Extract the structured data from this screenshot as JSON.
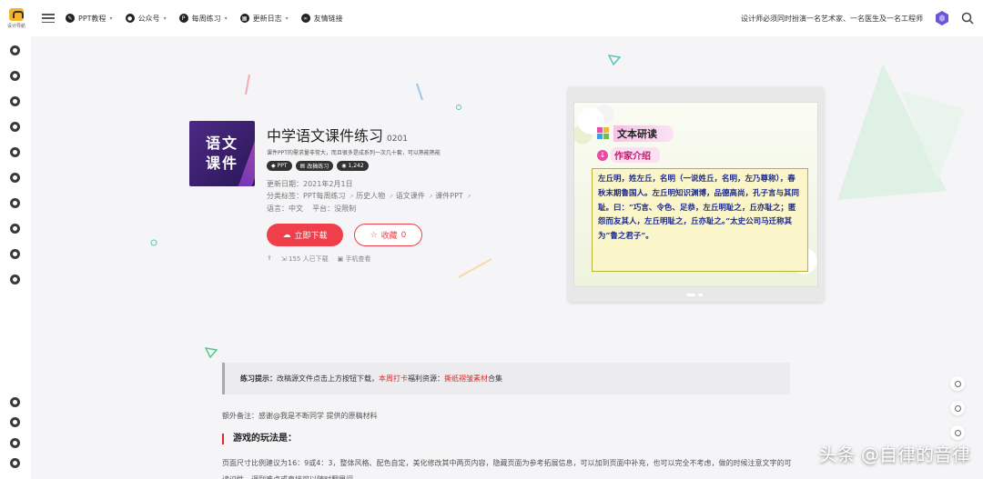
{
  "header": {
    "logo_text": "设计导航",
    "nav": [
      {
        "icon": "pencil-icon",
        "label": "PPT教程",
        "has_dropdown": true
      },
      {
        "icon": "wechat-icon",
        "label": "公众号",
        "has_dropdown": true
      },
      {
        "icon": "letter-p-icon",
        "label": "每周练习",
        "has_dropdown": true
      },
      {
        "icon": "calendar-icon",
        "label": "更新日志",
        "has_dropdown": true
      },
      {
        "icon": "handshake-icon",
        "label": "友情链接",
        "has_dropdown": false
      }
    ],
    "slogan": "设计师必须同时扮演一名艺术家、一名医生及一名工程师"
  },
  "resource": {
    "title": "中学语文课件练习",
    "code": "0201",
    "subtitle": "课件PPT的需求量非常大，而且很多是成系列一次几十套，可以熟能熟能",
    "cover_lines": [
      "语文",
      "课件"
    ],
    "tags": [
      {
        "icon": "diamond-icon",
        "label": "PPT"
      },
      {
        "icon": "document-icon",
        "label": "改稿练习"
      },
      {
        "icon": "eye-icon",
        "label": "1,242"
      }
    ],
    "update_label": "更新日期：",
    "update_date": "2021年2月1日",
    "category_label": "分类标签：",
    "categories": [
      "PPT每周练习",
      "历史人物",
      "语文课件",
      "课件PPT"
    ],
    "language_label": "语言：",
    "language": "中文",
    "platform_label": "平台：",
    "platform": "没限制",
    "download_label": "立即下载",
    "favorite_label": "收藏",
    "favorite_count": "0",
    "share_label": "",
    "downloads_text": "155 人已下载",
    "mobile_label": "手机查看"
  },
  "preview": {
    "heading": "文本研读",
    "subheading": "作家介绍",
    "body": "左丘明，姓左丘，名明（一说姓丘，名明，左乃尊称），春秋末期鲁国人。左丘明知识渊博，品德高尚，孔子言与其同耻。曰：“巧言、令色、足恭，左丘明耻之，丘亦耻之；匿怨而友其人，左丘明耻之，丘亦耻之。”太史公司马迁称其为“鲁之君子”。"
  },
  "content": {
    "notice_prefix": "练习提示：",
    "notice_text": "改稿源文件点击上方按钮下载，",
    "notice_link1": "本周打卡",
    "notice_mid": "福利资源：",
    "notice_link2": "撕纸褶皱素材",
    "notice_suffix": "合集",
    "remark": "额外备注：感谢@我是不断同学 提供的原稿材料",
    "section_title": "游戏的玩法是：",
    "paragraph": "页面尺寸比例建议为16：9或4：3，整体风格、配色自定，美化修改其中两页内容，隐藏页面为参考拓展信息，可以加到页面中补充，也可以完全不考虑，做的时候注意文字的可读识性，调到难点或直接可以随时翻里问"
  },
  "watermark": "头条 @自律的音律",
  "colors": {
    "accent_red": "#ef3f4a",
    "cover_purple": "#3d2070",
    "slide_text_blue": "#1b2a8a"
  }
}
